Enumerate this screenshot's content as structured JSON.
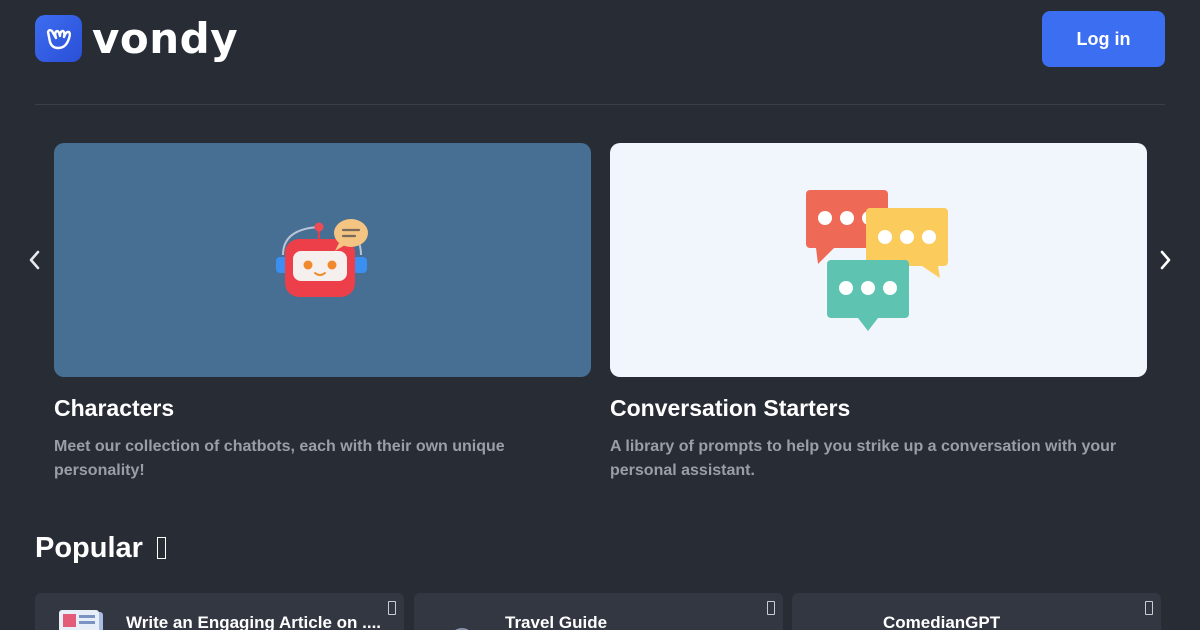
{
  "header": {
    "logo_text": "vondy",
    "login_label": "Log in"
  },
  "carousel": {
    "prev_icon": "chevron-left-icon",
    "next_icon": "chevron-right-icon",
    "cards": [
      {
        "title": "Characters",
        "description": "Meet our collection of chatbots, each with their own unique personality!",
        "icon": "robot-chat-icon",
        "bg_color": "#476e93"
      },
      {
        "title": "Conversation Starters",
        "description": "A library of prompts to help you strike up a conversation with your personal assistant.",
        "icon": "speech-bubbles-icon",
        "bg_color": "#f1f6fc"
      }
    ]
  },
  "popular": {
    "title": "Popular",
    "title_icon": "fire-icon",
    "items": [
      {
        "title": "Write an Engaging Article on ....",
        "icon": "newspaper-icon"
      },
      {
        "title": "Travel Guide",
        "icon": "traveler-icon"
      },
      {
        "title": "ComedianGPT",
        "icon": "crown-icon"
      }
    ]
  },
  "colors": {
    "background": "#282c35",
    "accent": "#3b6ef0",
    "card_surface": "#323742",
    "muted_text": "#9a9ea6"
  }
}
